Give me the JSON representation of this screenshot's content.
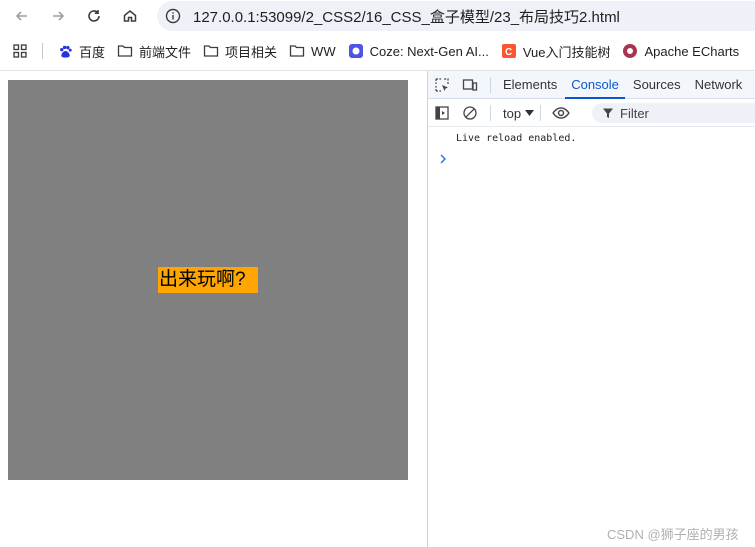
{
  "browser": {
    "url": "127.0.0.1:53099/2_CSS2/16_CSS_盒子模型/23_布局技巧2.html"
  },
  "bookmarks": [
    {
      "label": "百度",
      "icon": "paw-icon"
    },
    {
      "label": "前端文件",
      "icon": "folder-icon"
    },
    {
      "label": "项目相关",
      "icon": "folder-icon"
    },
    {
      "label": "WW",
      "icon": "folder-icon"
    },
    {
      "label": "Coze: Next-Gen AI...",
      "icon": "coze-icon"
    },
    {
      "label": "Vue入门技能树",
      "icon": "csdn-icon"
    },
    {
      "label": "Apache ECharts",
      "icon": "echarts-icon"
    }
  ],
  "page": {
    "text": "出来玩啊?"
  },
  "devtools": {
    "tabs": [
      "Elements",
      "Console",
      "Sources",
      "Network"
    ],
    "active_tab": "Console",
    "context": "top",
    "filter_placeholder": "Filter",
    "message": "Live reload enabled."
  },
  "watermark": "CSDN @狮子座的男孩",
  "colors": {
    "box": "#808080",
    "label_bg": "#ffa500",
    "accent": "#0b57d0"
  }
}
